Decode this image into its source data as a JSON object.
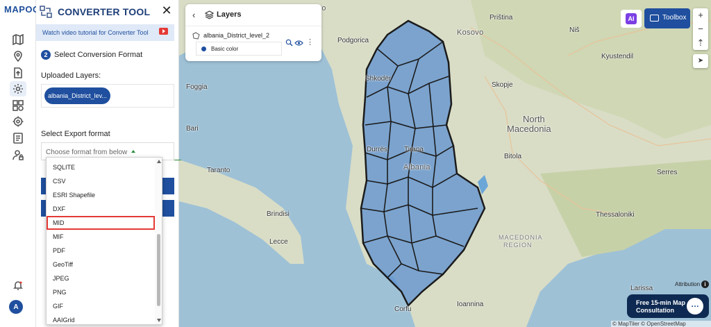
{
  "app": {
    "logo_text": "MAPOG"
  },
  "rail": {
    "items": [
      {
        "icon": "map-icon"
      },
      {
        "icon": "location-pin-icon"
      },
      {
        "icon": "upload-file-icon"
      },
      {
        "icon": "gear-icon",
        "active": true
      },
      {
        "icon": "grid-layers-icon"
      },
      {
        "icon": "target-settings-icon"
      },
      {
        "icon": "report-icon"
      },
      {
        "icon": "user-lock-icon"
      }
    ],
    "notification_icon": "bell-icon",
    "avatar_letter": "A"
  },
  "panel": {
    "title": "CONVERTER TOOL",
    "close": "✕",
    "tutorial_text": "Watch video tutorial for Converter Tool",
    "step_number": "2",
    "step_label": "Select Conversion Format",
    "uploaded_label": "Uploaded Layers:",
    "layer_chip": "albania_District_lev...",
    "export_label": "Select Export format",
    "format_placeholder": "Choose format from below",
    "options": [
      "SQLITE",
      "CSV",
      "ESRI Shapefile",
      "DXF",
      "MID",
      "MIF",
      "PDF",
      "GeoTiff",
      "JPEG",
      "PNG",
      "GIF",
      "AAIGrid"
    ],
    "highlighted_option": "MID"
  },
  "layers_card": {
    "back": "‹",
    "title": "Layers",
    "layer_name": "albania_District_level_2",
    "style_name": "Basic color",
    "more": "⋮"
  },
  "toolbar": {
    "ai_label": "AI",
    "toolbox_label": "Toolbox",
    "zoom_in": "+",
    "zoom_out": "−",
    "compass": "⇡",
    "locate": "➤"
  },
  "map": {
    "labels": [
      {
        "text": "Montenegro",
        "cls": "country"
      },
      {
        "text": "Priština",
        "cls": "city"
      },
      {
        "text": "Kosovo",
        "cls": "country"
      },
      {
        "text": "Podgorica",
        "cls": "city"
      },
      {
        "text": "Niš",
        "cls": "city"
      },
      {
        "text": "Kyustendil",
        "cls": "city"
      },
      {
        "text": "Skopje",
        "cls": "city"
      },
      {
        "text": "North",
        "cls": "big"
      },
      {
        "text": "Macedonia",
        "cls": "big"
      },
      {
        "text": "Tirana",
        "cls": "city"
      },
      {
        "text": "Albania",
        "cls": "country"
      },
      {
        "text": "Durrës",
        "cls": "city"
      },
      {
        "text": "Shkodër",
        "cls": "city"
      },
      {
        "text": "Serres",
        "cls": "city"
      },
      {
        "text": "Thessaloniki",
        "cls": "city"
      },
      {
        "text": "Brindisi",
        "cls": "city"
      },
      {
        "text": "Lecce",
        "cls": "city"
      },
      {
        "text": "MACEDONIA",
        "cls": "region"
      },
      {
        "text": "REGION",
        "cls": "region"
      },
      {
        "text": "Ioannina",
        "cls": "city"
      },
      {
        "text": "Corfu",
        "cls": "city"
      },
      {
        "text": "Larissa",
        "cls": "city"
      },
      {
        "text": "Bitola",
        "cls": "city"
      },
      {
        "text": "Bari",
        "cls": "city"
      },
      {
        "text": "Taranto",
        "cls": "city"
      },
      {
        "text": "Foggia",
        "cls": "city"
      }
    ]
  },
  "attribution_label": "Attribution",
  "attribution_icon": "i",
  "consult": {
    "line1": "Free 15-min Map",
    "line2": "Consultation"
  },
  "copyright": "© MapTiler © OpenStreetMap contributors"
}
